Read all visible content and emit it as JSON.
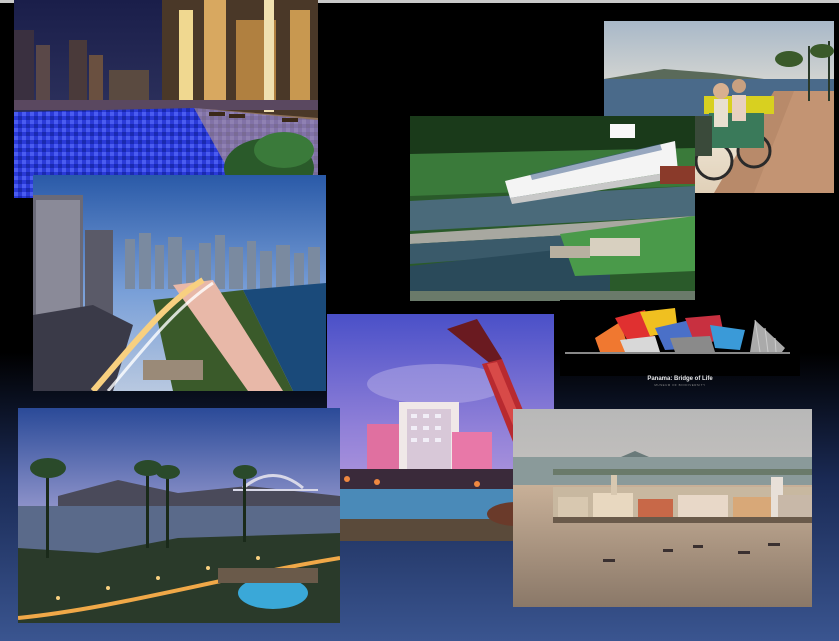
{
  "slide": {
    "background_top": "#000000",
    "background_bottom": "#3a5590"
  },
  "photos": [
    {
      "name": "hotel-pool-night-photo"
    },
    {
      "name": "city-skyline-dusk-photo"
    },
    {
      "name": "causeway-bicycle-photo"
    },
    {
      "name": "canal-locks-cruise-ship-photo"
    },
    {
      "name": "guitar-tower-hotel-photo"
    },
    {
      "name": "bay-bridge-sunset-photo"
    },
    {
      "name": "old-town-waterfront-photo"
    }
  ],
  "museum": {
    "caption": "Panama: Bridge of Life",
    "subcaption": "MUSEUM OF BIODIVERSITY"
  }
}
